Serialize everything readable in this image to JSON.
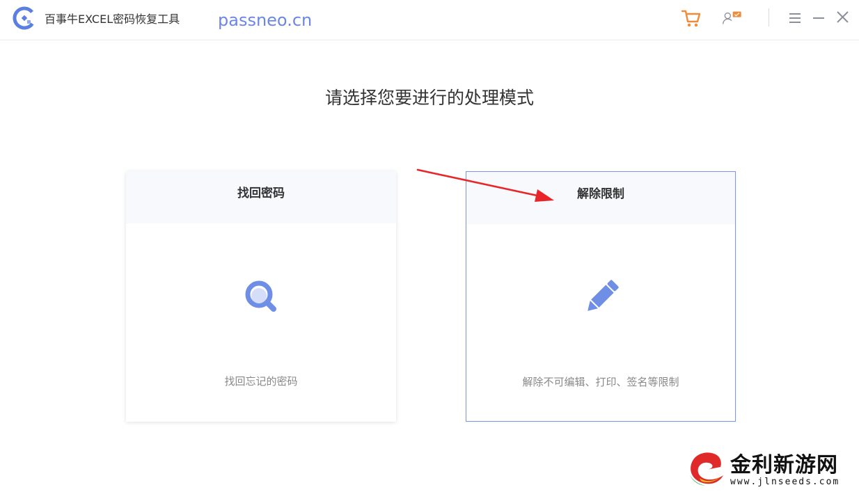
{
  "titlebar": {
    "app_name": "百事牛EXCEL密码恢复工具",
    "site": "passneo.cn",
    "icons": [
      "app-logo-icon",
      "cart-icon",
      "user-badge-icon",
      "menu-icon",
      "minimize-icon",
      "close-icon"
    ]
  },
  "main": {
    "prompt": "请选择您要进行的处理模式",
    "cards": [
      {
        "title": "找回密码",
        "description": "找回忘记的密码",
        "icon": "magnifier-icon"
      },
      {
        "title": "解除限制",
        "description": "解除不可编辑、打印、签名等限制",
        "icon": "pencil-icon",
        "selected": true
      }
    ]
  },
  "watermark": {
    "name": "金利新游网",
    "url": "www.jlnseeds.com"
  },
  "colors": {
    "accent": "#6c86e8",
    "cart": "#f08b3a",
    "arrow": "#e8262a",
    "card_head_bg": "#f8f9fd",
    "selected_border": "#7d95e6"
  }
}
